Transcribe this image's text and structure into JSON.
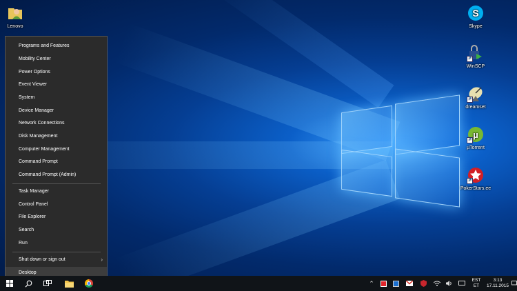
{
  "desktop": {
    "icons_left": [
      {
        "label": "Lenovo",
        "icon": "user-folder-icon"
      }
    ],
    "icons_right": [
      {
        "label": "Skype",
        "icon": "skype-icon",
        "color": "#00aff0"
      },
      {
        "label": "WinSCP",
        "icon": "winscp-icon",
        "color": "#3b7bd4"
      },
      {
        "label": "dreamset",
        "icon": "satellite-dish-icon",
        "color": "#e8e0b0"
      },
      {
        "label": "µTorrent",
        "icon": "utorrent-icon",
        "color": "#78b832"
      },
      {
        "label": "PokerStars.ee",
        "icon": "pokerstars-icon",
        "color": "#d21f26"
      }
    ]
  },
  "power_menu": {
    "items": [
      "Programs and Features",
      "Mobility Center",
      "Power Options",
      "Event Viewer",
      "System",
      "Device Manager",
      "Network Connections",
      "Disk Management",
      "Computer Management",
      "Command Prompt",
      "Command Prompt (Admin)",
      "Task Manager",
      "Control Panel",
      "File Explorer",
      "Search",
      "Run",
      "Shut down or sign out",
      "Desktop"
    ],
    "highlighted": "Desktop"
  },
  "taskbar": {
    "pinned": [
      "start-icon",
      "search-icon",
      "task-view-icon",
      "file-explorer-icon",
      "chrome-icon"
    ],
    "tray_icons": [
      "chevron-up-icon",
      "antivirus-icon",
      "app-icon",
      "gmail-icon",
      "shield-icon",
      "wifi-icon",
      "monitor-icon",
      "volume-icon",
      "chat-icon"
    ],
    "language": [
      "EST",
      "ET"
    ],
    "clock": {
      "time": "3:13",
      "date": "17.11.2015"
    }
  }
}
